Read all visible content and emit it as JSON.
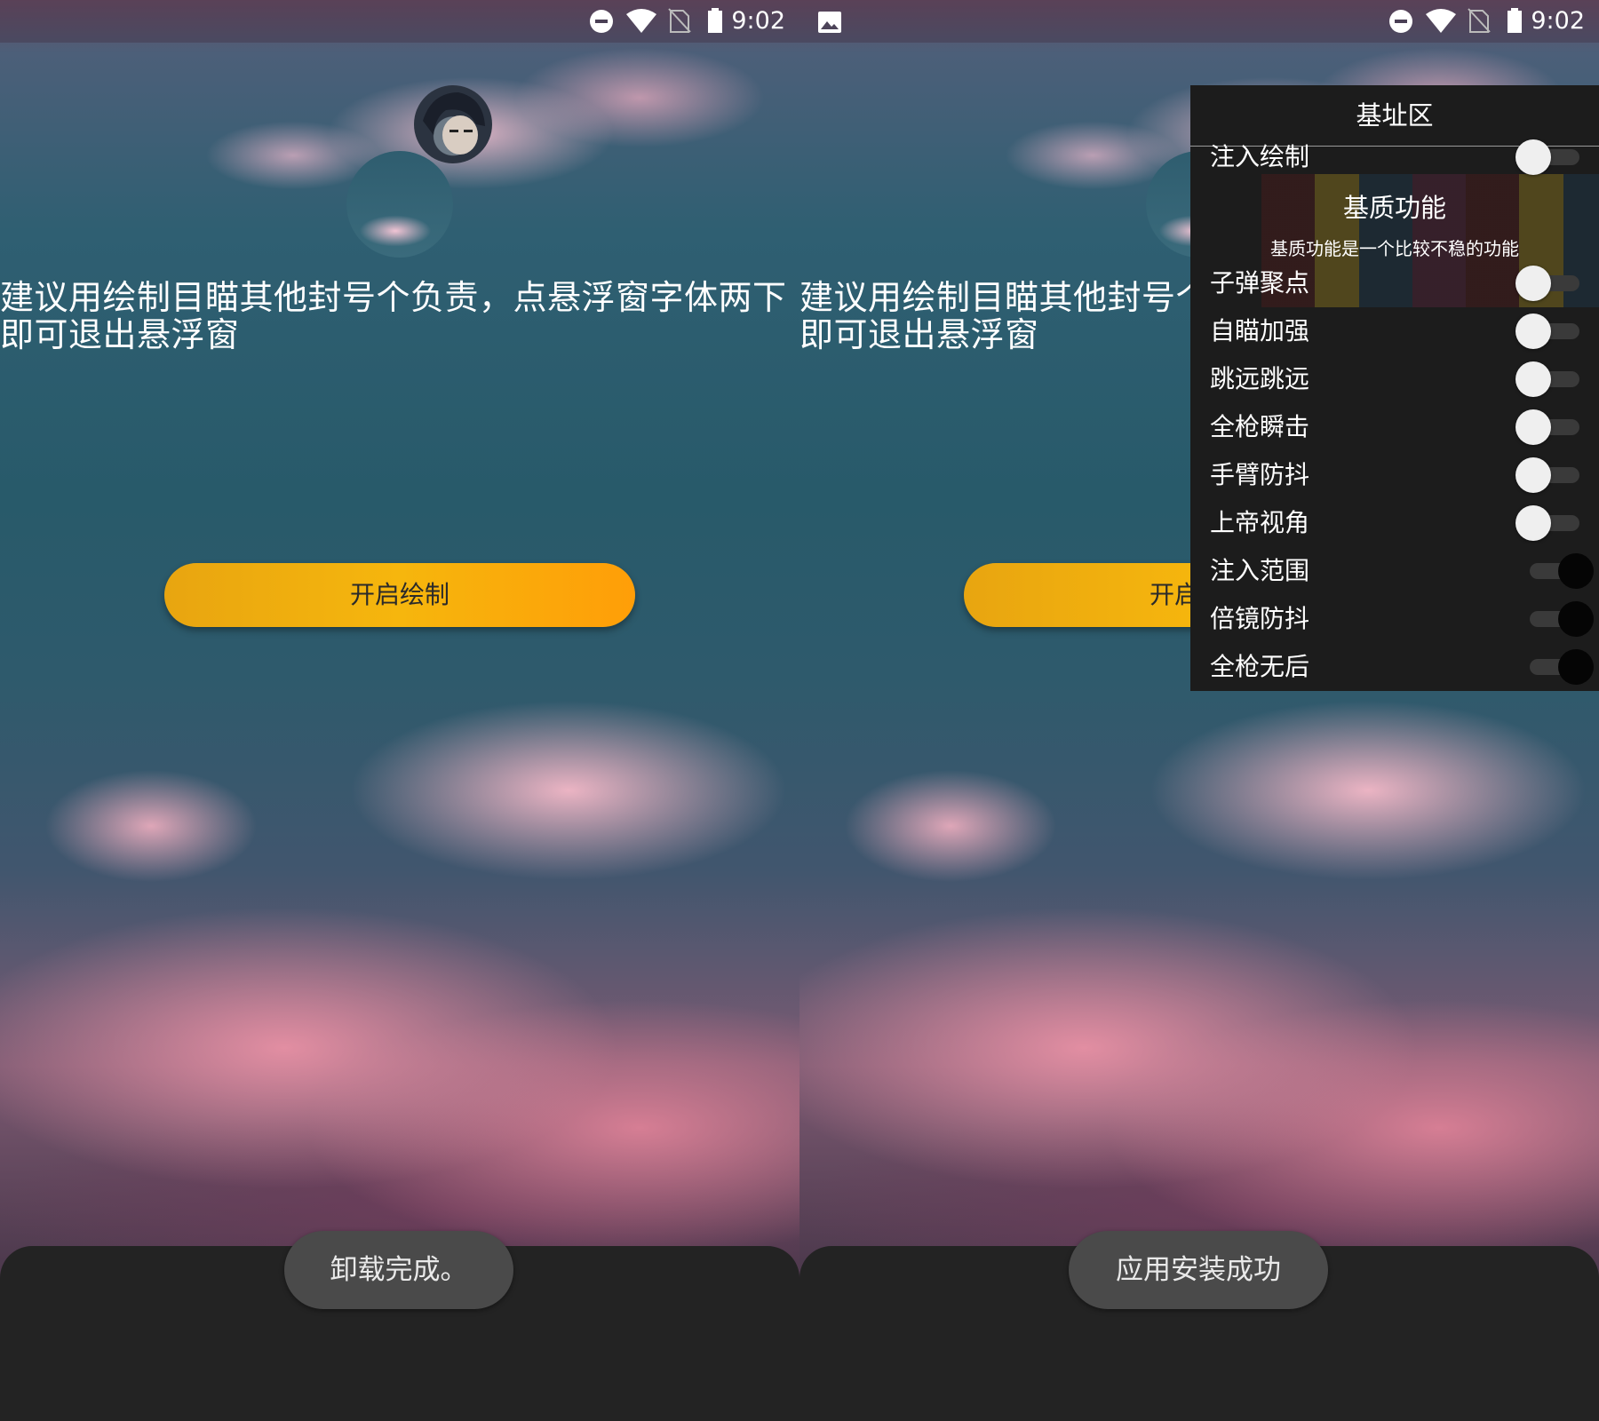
{
  "status": {
    "time": "9:02"
  },
  "main": {
    "notice": "建议用绘制目瞄其他封号个负责，点悬浮窗字体两下即可退出悬浮窗",
    "draw_button": "开启绘制"
  },
  "left": {
    "toast": "卸载完成。"
  },
  "right": {
    "toast": "应用安装成功"
  },
  "menu": {
    "header": "基址区",
    "top_item": {
      "label": "注入绘制",
      "state": "off"
    },
    "section_title": "基质功能",
    "section_subtitle": "基质功能是一个比较不稳的功能",
    "items": [
      {
        "label": "子弹聚点",
        "state": "off"
      },
      {
        "label": "自瞄加强",
        "state": "off"
      },
      {
        "label": "跳远跳远",
        "state": "off"
      },
      {
        "label": "全枪瞬击",
        "state": "off"
      },
      {
        "label": "手臂防抖",
        "state": "off"
      },
      {
        "label": "上帝视角",
        "state": "off"
      },
      {
        "label": "注入范围",
        "state": "on"
      },
      {
        "label": "倍镜防抖",
        "state": "on"
      },
      {
        "label": "全枪无后",
        "state": "on"
      }
    ]
  },
  "icons": [
    "do-not-disturb-icon",
    "wifi-icon",
    "no-sim-icon",
    "battery-icon",
    "gallery-icon"
  ]
}
